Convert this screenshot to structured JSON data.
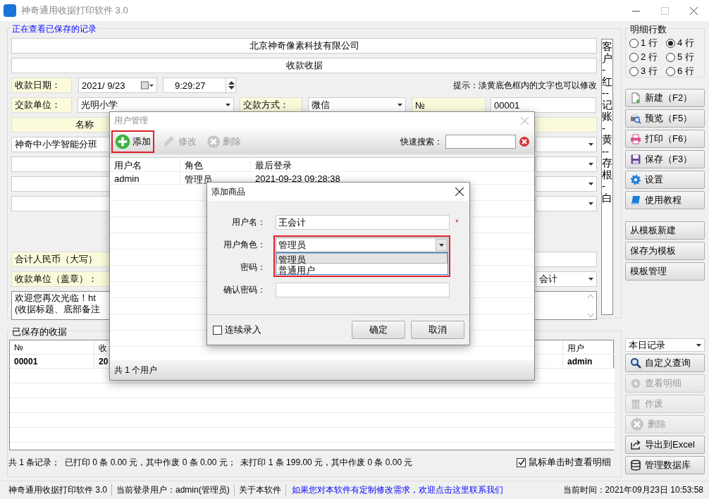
{
  "window": {
    "title": "神奇通用收据打印软件 3.0"
  },
  "form": {
    "caption": "正在查看已保存的记录",
    "company": "北京神奇像素科技有限公司",
    "doc_title": "收款收据",
    "date_label": "收款日期：",
    "date": "2021/ 9/23",
    "time": "9:29:27",
    "hint": "提示：淡黄底色框内的文字也可以修改",
    "payer_label": "交款单位：",
    "payer": "光明小学",
    "method_label": "交款方式：",
    "method": "微信",
    "no_label": "№",
    "no": "00001",
    "item_header": "名称",
    "item_name": "神奇中小学智能分班",
    "total_label": "合计人民币（大写）",
    "payee_label": "收款单位（盖章）：",
    "payee": "会计",
    "notes": [
      "欢迎您再次光临！ht",
      "(收据标题、底部备注"
    ],
    "copies": "客户-红--记账-黄--存根-白"
  },
  "detail_rows": {
    "title": "明细行数",
    "options": [
      {
        "label": "1 行",
        "selected": false
      },
      {
        "label": "2 行",
        "selected": false
      },
      {
        "label": "3 行",
        "selected": false
      },
      {
        "label": "4 行",
        "selected": true
      },
      {
        "label": "5 行",
        "selected": false
      },
      {
        "label": "6 行",
        "selected": false
      }
    ]
  },
  "actions": [
    {
      "label": "新建（F2）",
      "kind": "new"
    },
    {
      "label": "预览（F5）",
      "kind": "preview"
    },
    {
      "label": "打印（F6）",
      "kind": "print"
    },
    {
      "label": "保存（F3）",
      "kind": "save"
    },
    {
      "label": "设置",
      "kind": "settings"
    },
    {
      "label": "使用教程",
      "kind": "tutorial"
    }
  ],
  "template_actions": [
    "从模板新建",
    "保存为模板",
    "模板管理"
  ],
  "records": {
    "caption": "已保存的收据",
    "columns": [
      "№",
      "收",
      "用户"
    ],
    "rows": [
      {
        "cells": [
          "00001",
          "20",
          "admin"
        ]
      }
    ],
    "filter": "本日记录",
    "buttons": [
      {
        "label": "自定义查询",
        "kind": "search",
        "disabled": false
      },
      {
        "label": "查看明细",
        "kind": "view",
        "disabled": true
      },
      {
        "label": "作废",
        "kind": "trash",
        "disabled": true
      },
      {
        "label": "删除",
        "kind": "delete",
        "disabled": true
      },
      {
        "label": "导出到Excel",
        "kind": "export",
        "disabled": false
      },
      {
        "label": "管理数据库",
        "kind": "database",
        "disabled": false
      }
    ],
    "summary": "共 1 条记录；  已打印 0 条 0.00 元，其中作废 0 条 0.00 元；  未打印 1 条 199.00 元，其中作废 0 条 0.00 元",
    "click_detail": {
      "label": "鼠标单击时查看明细",
      "checked": true
    }
  },
  "status_bar": {
    "items": [
      "神奇通用收据打印软件 3.0",
      "当前登录用户：admin(管理员)",
      "关于本软件"
    ],
    "link": "如果您对本软件有定制修改需求，欢迎点击这里联系我们",
    "time": "当前时间：2021年09月23日 10:53:58"
  },
  "user_manager": {
    "title": "用户管理",
    "tools": [
      {
        "label": "添加",
        "kind": "add",
        "disabled": false,
        "highlighted": true
      },
      {
        "label": "修改",
        "kind": "edit",
        "disabled": true,
        "highlighted": false
      },
      {
        "label": "删除",
        "kind": "delete",
        "disabled": true,
        "highlighted": false
      }
    ],
    "search_label": "快速搜索：",
    "columns": [
      "用户名",
      "角色",
      "最后登录"
    ],
    "rows": [
      {
        "cells": [
          "admin",
          "管理员",
          "2021-09-23 09:28:38"
        ]
      }
    ],
    "footer": "共 1 个用户"
  },
  "add_dialog": {
    "title": "添加商品",
    "username_label": "用户名：",
    "username": "王会计",
    "required_mark": "*",
    "role_label": "用户角色：",
    "role": "管理员",
    "role_highlighted": true,
    "role_options": [
      {
        "label": "管理员",
        "selected": true
      },
      {
        "label": "普通用户",
        "selected": false
      }
    ],
    "password_label": "密码：",
    "confirm_label": "确认密码：",
    "continuous": {
      "label": "连续录入",
      "checked": false
    },
    "buttons": [
      "确定",
      "取消"
    ]
  }
}
